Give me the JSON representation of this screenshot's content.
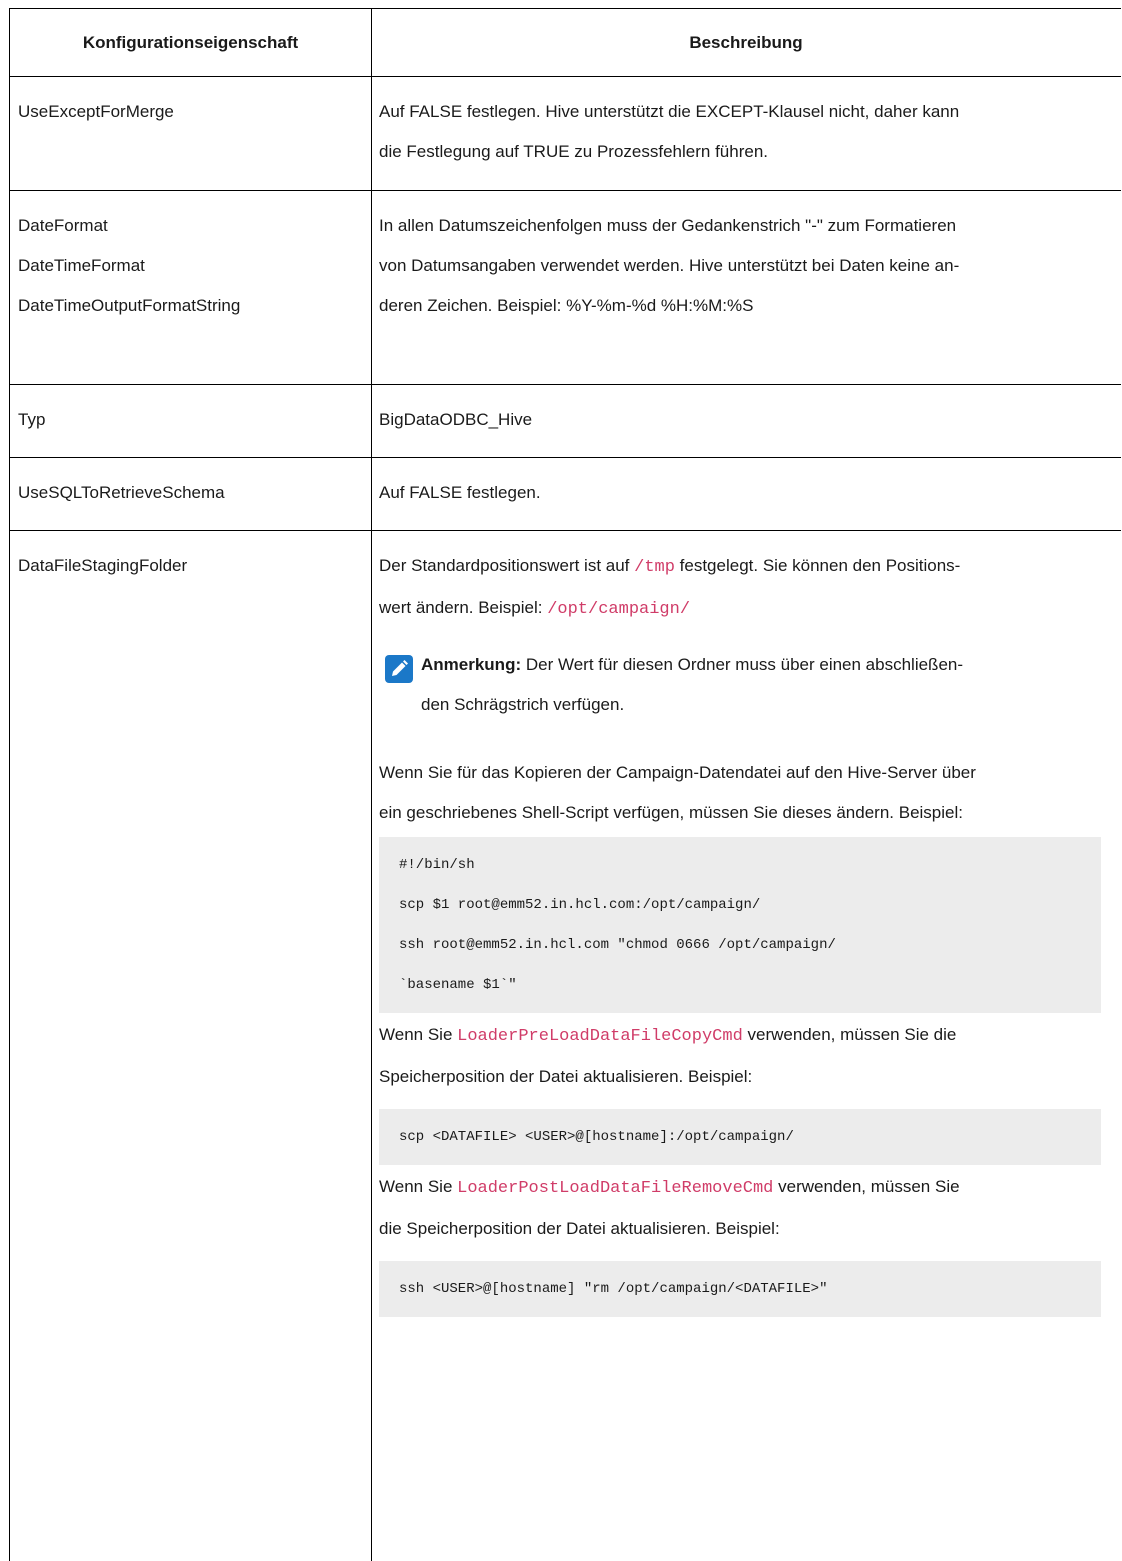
{
  "table": {
    "headers": [
      "Konfigurationseigenschaft",
      "Beschreibung"
    ],
    "rows": [
      {
        "props": [
          "UseExceptForMerge"
        ],
        "desc": [
          "Auf FALSE festlegen. Hive unterstützt die EXCEPT-Klausel nicht, daher kann",
          "die Festlegung auf TRUE zu Prozessfehlern führen."
        ]
      },
      {
        "props": [
          "DateFormat",
          "DateTimeFormat",
          "DateTimeOutputFormatString"
        ],
        "desc": [
          "In allen Datumszeichenfolgen muss der Gedankenstrich \"-\" zum Formatieren",
          "von Datumsangaben verwendet werden. Hive unterstützt bei Daten keine an-",
          "deren Zeichen. Beispiel: %Y-%m-%d %H:%M:%S"
        ]
      },
      {
        "props": [
          "Typ"
        ],
        "desc": [
          "BigDataODBC_Hive"
        ]
      },
      {
        "props": [
          "UseSQLToRetrieveSchema"
        ],
        "desc": [
          "Auf FALSE festlegen."
        ]
      },
      {
        "props": [
          "DataFileStagingFolder"
        ],
        "p1_a": "Der Standardpositionswert ist auf ",
        "p1_code": "/tmp",
        "p1_b": " festgelegt. Sie können den Positions-",
        "p1_c": "wert ändern. Beispiel: ",
        "p1_code2": "/opt/campaign/",
        "note_label": "Anmerkung:",
        "note_line1": " Der Wert für diesen Ordner muss über einen abschließen-",
        "note_line2": "den Schrägstrich verfügen.",
        "p2_l1": "Wenn Sie für das Kopieren der Campaign-Datendatei auf den Hive-Server über",
        "p2_l2": "ein geschriebenes Shell-Script verfügen, müssen Sie dieses ändern. Beispiel:",
        "code1": [
          "#!/bin/sh",
          "scp $1 root@emm52.in.hcl.com:/opt/campaign/",
          "ssh root@emm52.in.hcl.com \"chmod 0666 /opt/campaign/",
          "`basename $1`\""
        ],
        "p3_a": "Wenn Sie ",
        "p3_code": "LoaderPreLoadDataFileCopyCmd",
        "p3_b": " verwenden, müssen Sie die",
        "p3_l2": "Speicherposition der Datei aktualisieren. Beispiel:",
        "code2": [
          "scp <DATAFILE> <USER>@[hostname]:/opt/campaign/"
        ],
        "p4_a": "Wenn Sie ",
        "p4_code": "LoaderPostLoadDataFileRemoveCmd",
        "p4_b": " verwenden, müssen Sie",
        "p4_l2": "die Speicherposition der Datei aktualisieren. Beispiel:",
        "code3": [
          "ssh <USER>@[hostname] \"rm /opt/campaign/<DATAFILE>\""
        ]
      }
    ]
  },
  "icons": {
    "note": "pencil-note-icon"
  },
  "colors": {
    "code_inline": "#d03c68",
    "note_icon_bg": "#1b78c8",
    "code_block_bg": "#ececec"
  }
}
